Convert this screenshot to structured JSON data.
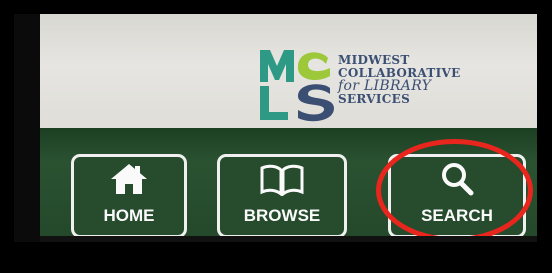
{
  "logo": {
    "letters": "MCLS",
    "line1": "MIDWEST",
    "line2": "COLLABORATIVE",
    "line3": "for LIBRARY",
    "line4": "SERVICES"
  },
  "nav": {
    "home_label": "HOME",
    "browse_label": "BROWSE",
    "search_label": "SEARCH",
    "home_icon": "house-icon",
    "browse_icon": "open-book-icon",
    "search_icon": "magnifier-icon"
  },
  "colors": {
    "nav_green": "#264b2d",
    "header_bg": "#e0dfda",
    "logo_blue": "#3b4f73",
    "highlight_red": "#e8261d"
  }
}
